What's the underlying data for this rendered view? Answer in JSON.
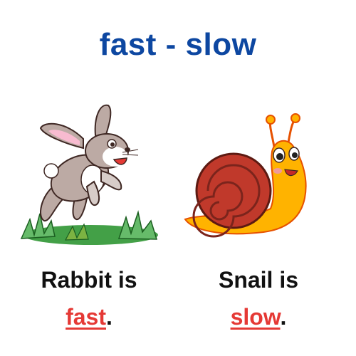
{
  "title": "fast - slow",
  "rabbit": {
    "caption_line1": "Rabbit is",
    "adjective": "fast",
    "punctuation": "."
  },
  "snail": {
    "caption_line1": "Snail is",
    "adjective": "slow",
    "punctuation": "."
  },
  "colors": {
    "title": "#0d47a1",
    "adjective": "#e53935",
    "text": "#111111"
  }
}
